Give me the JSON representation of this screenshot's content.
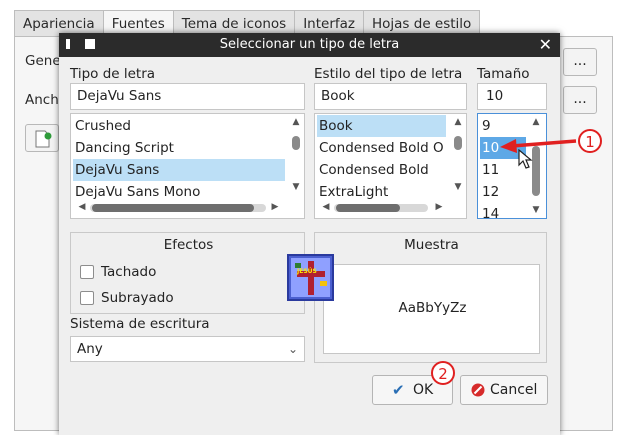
{
  "background_window": {
    "tabs": [
      "Apariencia",
      "Fuentes",
      "Tema de iconos",
      "Interfaz",
      "Hojas de estilo"
    ],
    "active_tab": 1,
    "labels": [
      "Gene",
      "Anch"
    ],
    "dots_button": "..."
  },
  "dialog": {
    "title": "Seleccionar un tipo de letra",
    "family": {
      "label": "Tipo de letra",
      "value": "DejaVu Sans",
      "items": [
        "Crushed",
        "Dancing Script",
        "DejaVu Sans",
        "DejaVu Sans Mono"
      ],
      "selected_index": 2
    },
    "style": {
      "label": "Estilo del tipo de letra",
      "value": "Book",
      "items": [
        "Book",
        "Condensed Bold O",
        "Condensed Bold",
        "ExtraLight"
      ],
      "selected_index": 0
    },
    "size": {
      "label": "Tamaño",
      "value": "10",
      "items": [
        "9",
        "10",
        "11",
        "12",
        "14"
      ],
      "selected_index": 1
    },
    "effects": {
      "title": "Efectos",
      "strikeout_label": "Tachado",
      "underline_label": "Subrayado"
    },
    "writing_system": {
      "label": "Sistema de escritura",
      "value": "Any"
    },
    "sample": {
      "title": "Muestra",
      "text": "AaBbYyZz"
    },
    "ok_label": "OK",
    "cancel_label": "Cancel"
  },
  "annotations": {
    "badge1": "1",
    "badge2": "2",
    "logo_text": "JESÚS"
  },
  "colors": {
    "selection": "#bcdff6",
    "annotation_red": "#e02020",
    "titlebar": "#2b2b2b"
  }
}
